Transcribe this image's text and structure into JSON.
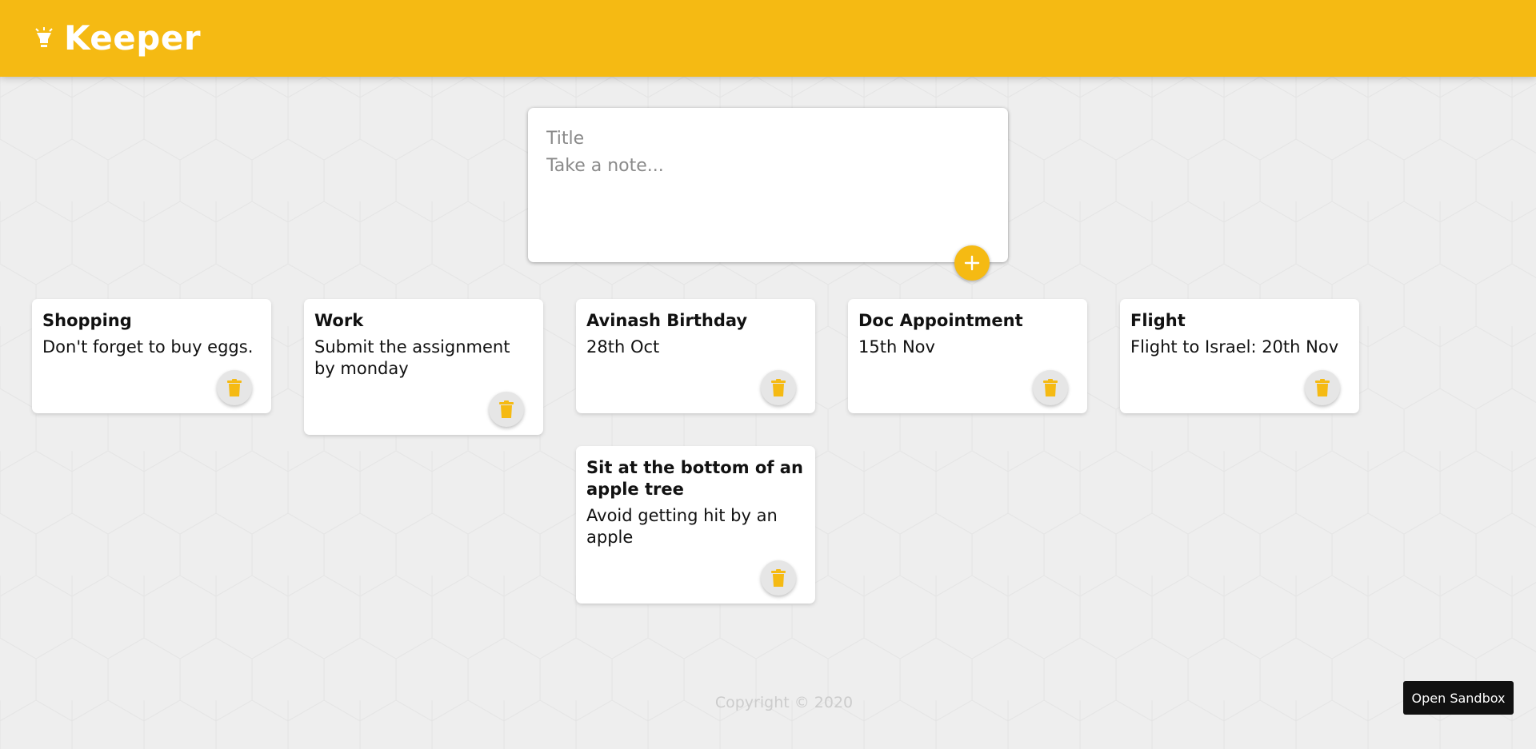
{
  "header": {
    "brand": "Keeper",
    "logo_icon": "lightbulb-icon"
  },
  "create_note": {
    "title_placeholder": "Title",
    "content_placeholder": "Take a note...",
    "add_icon": "plus-icon"
  },
  "notes": [
    {
      "title": "Shopping",
      "content": "Don't forget to buy eggs."
    },
    {
      "title": "Work",
      "content": "Submit the assignment by monday"
    },
    {
      "title": "Avinash Birthday",
      "content": "28th Oct"
    },
    {
      "title": "Doc Appointment",
      "content": "15th Nov"
    },
    {
      "title": "Flight",
      "content": "Flight to Israel: 20th Nov"
    },
    {
      "title": "Sit at the bottom of an apple tree",
      "content": "Avoid getting hit by an apple"
    }
  ],
  "delete_icon": "trash-icon",
  "footer": {
    "copyright": "Copyright © 2020"
  },
  "sandbox": {
    "label": "Open Sandbox"
  },
  "colors": {
    "accent": "#f5ba13",
    "background": "#eeeeee"
  }
}
